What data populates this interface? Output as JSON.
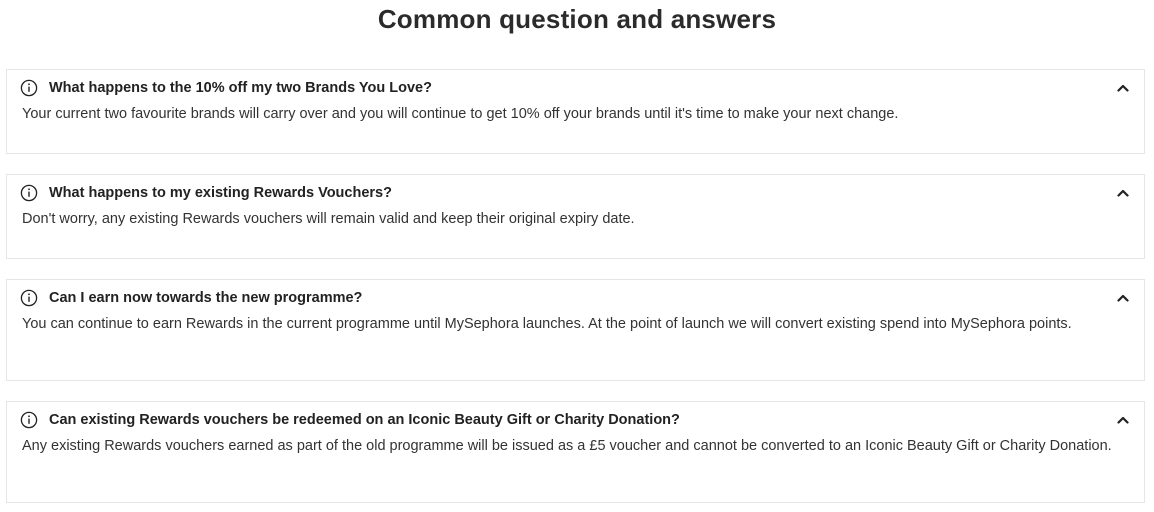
{
  "page": {
    "title": "Common question and answers"
  },
  "faq": [
    {
      "question": "What happens to the 10% off my two Brands You Love?",
      "answer": "Your current two favourite brands will carry over and you will continue to get 10% off your brands until it's time to make your next change."
    },
    {
      "question": "What happens to my existing Rewards Vouchers?",
      "answer": "Don't worry, any existing Rewards vouchers will remain valid and keep their original expiry date."
    },
    {
      "question": "Can I earn now towards the new programme?",
      "answer": "You can continue to earn Rewards in the current programme until MySephora launches. At the point of launch we will convert existing spend into MySephora points."
    },
    {
      "question": "Can existing Rewards vouchers be redeemed on an Iconic Beauty Gift or Charity Donation?",
      "answer": "Any existing Rewards vouchers earned as part of the old programme will be issued as a £5 voucher and cannot be converted to an Iconic Beauty Gift or Charity Donation."
    }
  ],
  "icons": {
    "info": "info-icon",
    "toggle": "chevron-up-icon"
  }
}
